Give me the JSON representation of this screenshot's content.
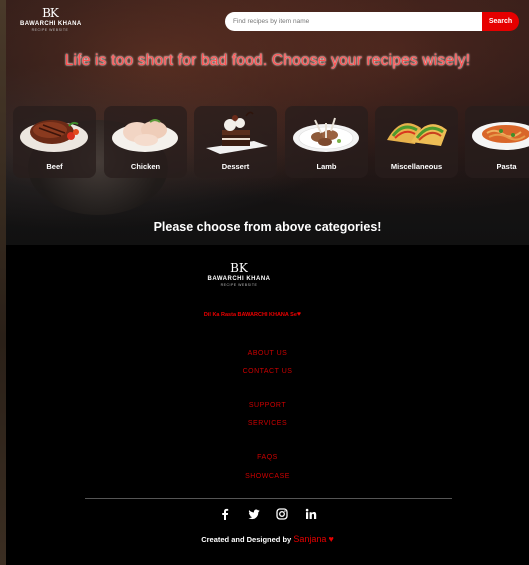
{
  "header": {
    "logo": {
      "monogram": "BK",
      "brand": "BAWARCHI KHANA",
      "tagline": "RECIPE WEBSITE"
    },
    "search": {
      "placeholder": "Find recipes by item name",
      "value": "",
      "button_label": "Search"
    }
  },
  "hero": {
    "tagline": "Life is too short for bad food. Choose your recipes wisely!"
  },
  "categories": [
    {
      "label": "Beef",
      "icon": "steak-image"
    },
    {
      "label": "Chicken",
      "icon": "raw-chicken-image"
    },
    {
      "label": "Dessert",
      "icon": "chocolate-cake-image"
    },
    {
      "label": "Lamb",
      "icon": "lamb-chops-image"
    },
    {
      "label": "Miscellaneous",
      "icon": "tacos-image"
    },
    {
      "label": "Pasta",
      "icon": "pasta-plate-image"
    }
  ],
  "prompt": "Please choose from above categories!",
  "footer": {
    "logo": {
      "monogram": "BK",
      "brand": "BAWARCHI KHANA",
      "tagline": "RECIPE WEBSITE"
    },
    "motto": "Dil Ka Rasta BAWARCHI KHANA Se",
    "links": [
      "ABOUT US",
      "CONTACT US",
      "SUPPORT",
      "SERVICES",
      "FAQS",
      "SHOWCASE"
    ],
    "social": [
      "facebook-icon",
      "twitter-icon",
      "instagram-icon",
      "linkedin-icon"
    ],
    "credit_prefix": "Created and Designed by",
    "credit_author": "Sanjana"
  },
  "colors": {
    "accent": "#e60000",
    "tagline": "#ff4f4f",
    "footer_link": "#c00000",
    "background": "#000000"
  }
}
